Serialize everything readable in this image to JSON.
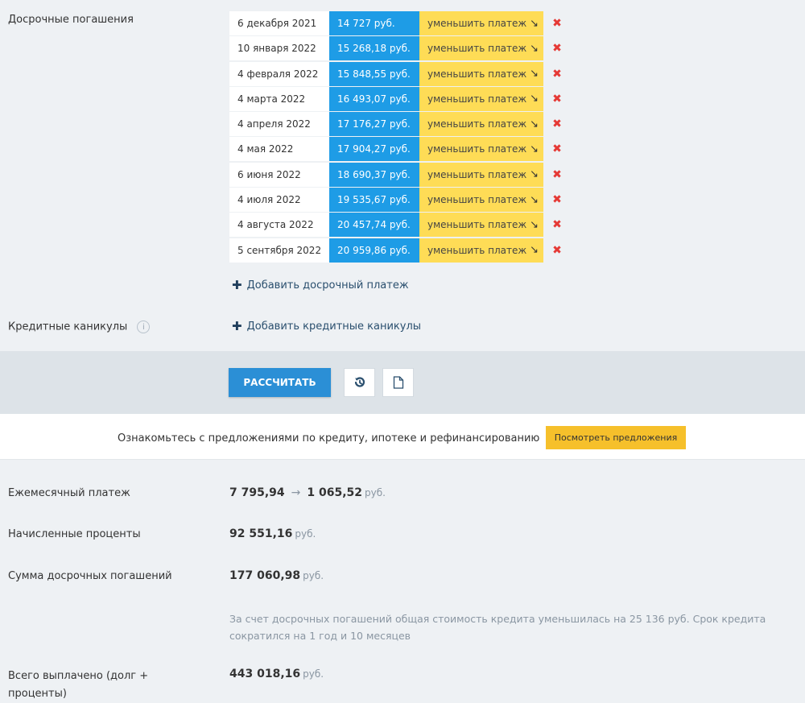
{
  "prepayments": {
    "label": "Досрочные погашения",
    "rows": [
      {
        "date": "6 декабря 2021",
        "amount": "14 727 руб.",
        "mode": "уменьшить платеж",
        "arrow": "↘"
      },
      {
        "date": "10 января 2022",
        "amount": "15 268,18 руб.",
        "mode": "уменьшить платеж",
        "arrow": "↘"
      },
      {
        "date": "4 февраля 2022",
        "amount": "15 848,55 руб.",
        "mode": "уменьшить платеж",
        "arrow": "↘"
      },
      {
        "date": "4 марта 2022",
        "amount": "16 493,07 руб.",
        "mode": "уменьшить платеж",
        "arrow": "↘"
      },
      {
        "date": "4 апреля 2022",
        "amount": "17 176,27 руб.",
        "mode": "уменьшить платеж",
        "arrow": "↘"
      },
      {
        "date": "4 мая 2022",
        "amount": "17 904,27 руб.",
        "mode": "уменьшить платеж",
        "arrow": "↘"
      },
      {
        "date": "6 июня 2022",
        "amount": "18 690,37 руб.",
        "mode": "уменьшить платеж",
        "arrow": "↘"
      },
      {
        "date": "4 июля 2022",
        "amount": "19 535,67 руб.",
        "mode": "уменьшить платеж",
        "arrow": "↘"
      },
      {
        "date": "4 августа 2022",
        "amount": "20 457,74 руб.",
        "mode": "уменьшить платеж",
        "arrow": "↘"
      },
      {
        "date": "5 сентября 2022",
        "amount": "20 959,86 руб.",
        "mode": "уменьшить платеж",
        "arrow": "↘"
      }
    ],
    "delete_symbol": "✖",
    "add_label": "Добавить досрочный платеж"
  },
  "holidays": {
    "label": "Кредитные каникулы",
    "info_symbol": "i",
    "add_label": "Добавить кредитные каникулы"
  },
  "actions": {
    "calculate_label": "РАССЧИТАТЬ"
  },
  "offers": {
    "text": "Ознакомьтесь с предложениями по кредиту, ипотеке и рефинансированию",
    "button_label": "Посмотреть предложения"
  },
  "results": {
    "monthly": {
      "label": "Ежемесячный платеж",
      "before": "7 795,94",
      "arrow": "→",
      "after": "1 065,52",
      "unit": "руб."
    },
    "interest": {
      "label": "Начисленные проценты",
      "value": "92 551,16",
      "unit": "руб."
    },
    "prepay_sum": {
      "label": "Сумма досрочных погашений",
      "value": "177 060,98",
      "unit": "руб."
    },
    "note": "За счет досрочных погашений общая стоимость кредита уменьшилась на 25 136 руб. Срок кредита сократился на 1 год и 10 месяцев",
    "total": {
      "label": "Всего выплачено (долг + проценты)",
      "value": "443 018,16",
      "unit": "руб."
    }
  },
  "colors": {
    "amount_bg": "#1e9ce6",
    "mode_bg": "#fedc56",
    "delete": "#e53935",
    "calc_button": "#2b8fd6",
    "offers_button": "#f6c02b"
  }
}
